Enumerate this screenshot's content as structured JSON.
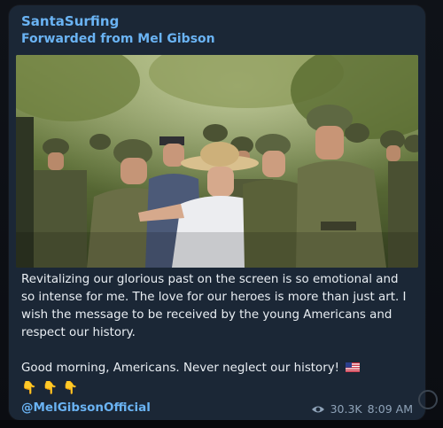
{
  "post": {
    "channel": "SantaSurfing",
    "forwarded": "Forwarded from Mel Gibson",
    "paragraph1": "Revitalizing our glorious past on the screen is so emotional and so intense for me. The love for our heroes is more than just art. I wish the message to be received by the young Americans and respect our history.",
    "paragraph2": "Good morning, Americans. Never neglect our history!",
    "flag_icon": "us-flag-icon",
    "pointing_icons": "pointing-down-icons",
    "handle": "@MelGibsonOfficial",
    "views": "30.3K",
    "time": "8:09 AM"
  },
  "colors": {
    "bubble": "#1b2736",
    "link": "#6ab3f3",
    "text": "#e9eef3",
    "meta": "#8fa3b8"
  }
}
